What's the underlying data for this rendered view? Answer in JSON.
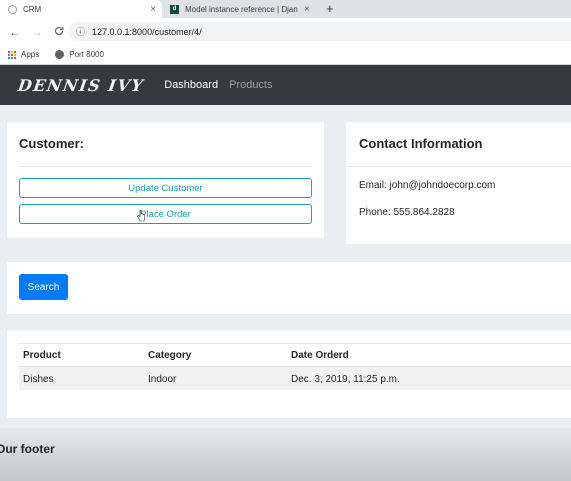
{
  "browser": {
    "tabs": [
      {
        "title": "CRM",
        "close": "×"
      },
      {
        "title": "Model instance reference | Djan",
        "close": "×"
      }
    ],
    "new_tab": "+",
    "url": "127.0.0.1:8000/customer/4/",
    "nav": {
      "back": "←",
      "forward": "→",
      "reload": "C",
      "info": "ⓘ"
    },
    "bookmarks": [
      {
        "label": "Apps",
        "icon": "apps-grid-icon"
      },
      {
        "label": "Port 8000",
        "icon": "globe-icon"
      }
    ]
  },
  "navbar": {
    "brand": "DENNIS IVY",
    "links": [
      {
        "label": "Dashboard",
        "active": true
      },
      {
        "label": "Products",
        "active": false
      }
    ]
  },
  "customer_card": {
    "title": "Customer:",
    "update_button": "Update Customer",
    "place_order_button": "Place Order"
  },
  "contact_card": {
    "title": "Contact Information",
    "email": "Email: john@johndoecorp.com",
    "phone": "Phone: 555.864.2828"
  },
  "search_card": {
    "button": "Search"
  },
  "orders_table": {
    "headers": [
      "Product",
      "Category",
      "Date Orderd"
    ],
    "rows": [
      [
        "Dishes",
        "Indoor",
        "Dec. 3, 2019, 11:25 p.m."
      ]
    ]
  },
  "footer": {
    "text": "Our footer"
  },
  "colors": {
    "navbar": "#343a40",
    "info_outline": "#17a2b8",
    "primary": "#007bff",
    "page_bg": "#ebeef1"
  }
}
